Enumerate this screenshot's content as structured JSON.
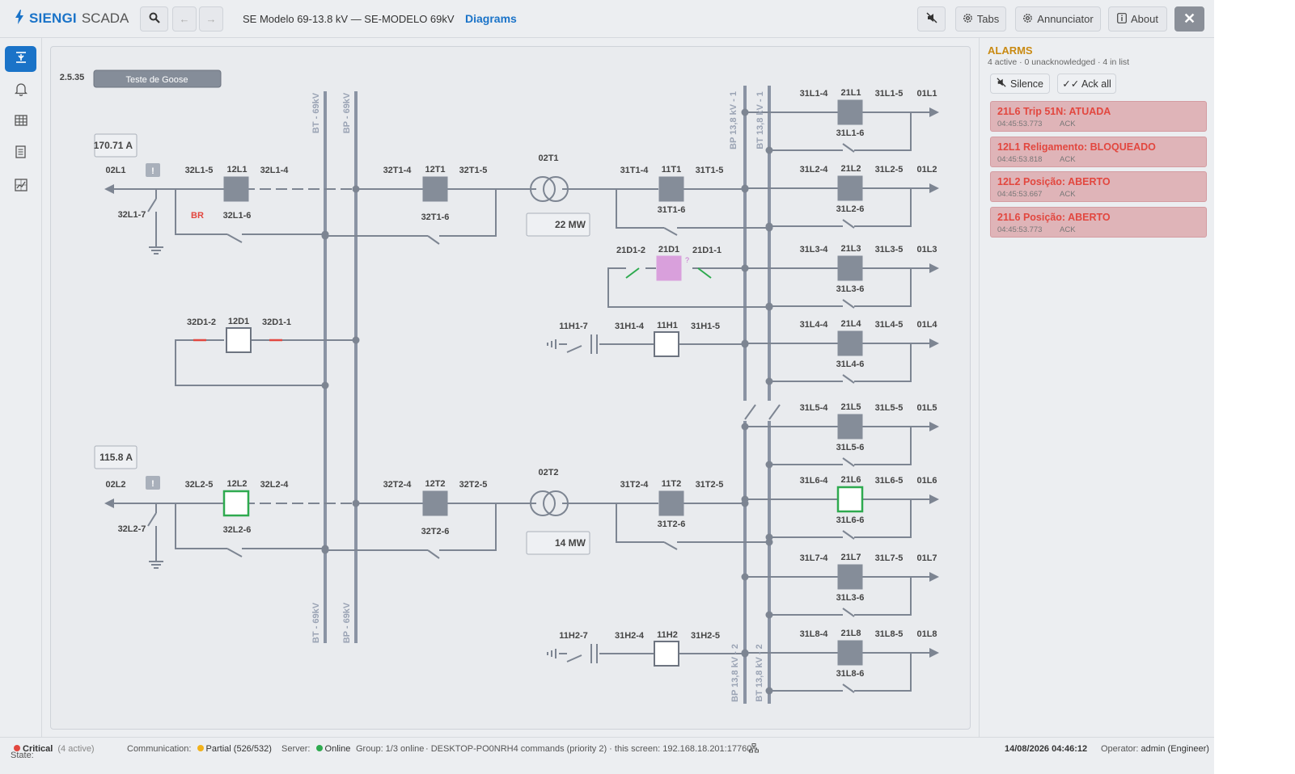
{
  "app": {
    "brand_primary": "SIENGI",
    "brand_secondary": "SCADA",
    "window_title": "SE Modelo 69-13.8 kV — SE-MODELO 69kV",
    "diagrams_link": "Diagrams",
    "back_glyph": "←",
    "forward_glyph": "→",
    "tabs_label": "Tabs",
    "annunciator_label": "Annunciator",
    "about_label": "About",
    "close_glyph": "✕"
  },
  "sidebar": {
    "items": [
      {
        "icon": "single-line-icon",
        "active": true
      },
      {
        "icon": "bell-icon",
        "active": false
      },
      {
        "icon": "table-icon",
        "active": false
      },
      {
        "icon": "document-icon",
        "active": false
      },
      {
        "icon": "chart-icon",
        "active": false
      }
    ]
  },
  "diagram": {
    "version": "2.5.35",
    "goose_button": "Teste de Goose",
    "readouts": {
      "l1": "170.71 A",
      "l2": "115.8 A",
      "t1": "22 MW",
      "t2": "14 MW"
    },
    "bus_labels": {
      "bt69_top": "BT - 69kV",
      "bp69_top": "BP - 69kV",
      "bt69_bot": "BT - 69kV",
      "bp69_bot": "BP - 69kV",
      "bp138_1": "BP 13,8 kV - 1",
      "bt138_1": "BT 13,8 kV - 1",
      "bp138_2": "BP 13,8 kV - 2",
      "bt138_2": "BT 13,8 kV - 2"
    },
    "labels": {
      "l02L1": "02L1",
      "l32L1_5": "32L1-5",
      "l12L1": "12L1",
      "l32L1_4": "32L1-4",
      "l32L1_7": "32L1-7",
      "lBR": "BR",
      "l32L1_6": "32L1-6",
      "l32T1_4": "32T1-4",
      "l12T1": "12T1",
      "l32T1_5": "32T1-5",
      "l32T1_6": "32T1-6",
      "l02T1": "02T1",
      "l31T1_4": "31T1-4",
      "l11T1": "11T1",
      "l31T1_5": "31T1-5",
      "l31T1_6": "31T1-6",
      "l32D1_2": "32D1-2",
      "l12D1": "12D1",
      "l32D1_1": "32D1-1",
      "l21D1_2": "21D1-2",
      "l21D1": "21D1",
      "l21D1_1": "21D1-1",
      "l11H1_7": "11H1-7",
      "l31H1_4": "31H1-4",
      "l11H1": "11H1",
      "l31H1_5": "31H1-5",
      "l02L2": "02L2",
      "l32L2_5": "32L2-5",
      "l12L2": "12L2",
      "l32L2_4": "32L2-4",
      "l32L2_7": "32L2-7",
      "l32L2_6": "32L2-6",
      "l32T2_4": "32T2-4",
      "l12T2": "12T2",
      "l32T2_5": "32T2-5",
      "l32T2_6": "32T2-6",
      "l02T2": "02T2",
      "l31T2_4": "31T2-4",
      "l11T2": "11T2",
      "l31T2_5": "31T2-5",
      "l31T2_6": "31T2-6",
      "l11H2_7": "11H2-7",
      "l31H2_4": "31H2-4",
      "l11H2": "11H2",
      "l31H2_5": "31H2-5",
      "l31L1_4": "31L1-4",
      "l21L1": "21L1",
      "l31L1_5": "31L1-5",
      "l01L1": "01L1",
      "l31L1_6": "31L1-6",
      "l31L2_4": "31L2-4",
      "l21L2": "21L2",
      "l31L2_5": "31L2-5",
      "l01L2": "01L2",
      "l31L2_6": "31L2-6",
      "l31L3_4": "31L3-4",
      "l21L3": "21L3",
      "l31L3_5": "31L3-5",
      "l01L3": "01L3",
      "l31L3_6": "31L3-6",
      "l31L4_4": "31L4-4",
      "l21L4": "21L4",
      "l31L4_5": "31L4-5",
      "l01L4": "01L4",
      "l31L4_6": "31L4-6",
      "l31L5_4": "31L5-4",
      "l21L5": "21L5",
      "l31L5_5": "31L5-5",
      "l01L5": "01L5",
      "l31L5_6": "31L5-6",
      "l31L6_4": "31L6-4",
      "l21L6": "21L6",
      "l31L6_5": "31L6-5",
      "l01L6": "01L6",
      "l31L6_6": "31L6-6",
      "l31L7_4": "31L7-4",
      "l21L7": "21L7",
      "l31L7_5": "31L7-5",
      "l01L7": "01L7",
      "l31L7_6": "31L3-6",
      "l31L8_4": "31L8-4",
      "l21L8": "21L8",
      "l31L8_5": "31L8-5",
      "l01L8": "01L8",
      "l31L8_6": "31L8-6"
    },
    "colors": {
      "bus": "#8a93a3",
      "line": "#7d8592",
      "breaker_closed": "#858d99",
      "breaker_open": "#ffffff",
      "breaker_green": "#2eaa4f",
      "breaker_magenta": "#d9a0dc",
      "label": "#444444",
      "bus_label": "#9aa3b4",
      "warning_red": "#e2473f"
    }
  },
  "alarms": {
    "title": "ALARMS",
    "summary": "4 active · 0 unacknowledged · 4 in list",
    "silence_label": "Silence",
    "ack_all_label": "✓✓ Ack all",
    "items": [
      {
        "text": "21L6 Trip 51N: ATUADA",
        "time": "04:45:53.773",
        "ack": "ACK"
      },
      {
        "text": "12L1 Religamento: BLOQUEADO",
        "time": "04:45:53.818",
        "ack": "ACK"
      },
      {
        "text": "12L2 Posição: ABERTO",
        "time": "04:45:53.667",
        "ack": "ACK"
      },
      {
        "text": "21L6 Posição: ABERTO",
        "time": "04:45:53.773",
        "ack": "ACK"
      }
    ]
  },
  "status": {
    "state_label": "State:",
    "state_value": "Critical",
    "state_extra": "(4 active)",
    "comm_label": "Communication:",
    "comm_value": "Partial (526/532)",
    "server_label": "Server:",
    "server_value": "Online",
    "group_text": "Group: 1/3 online",
    "commands_text": "· DESKTOP-PO0NRH4 commands (priority 2) · this screen: 192.168.18.201:17760",
    "datetime": "14/08/2026 04:46:12",
    "operator_label": "Operator:",
    "operator_value": "admin (Engineer)",
    "colors": {
      "critical": "#e2473f",
      "partial": "#f2b21b",
      "online": "#2eaa4f"
    }
  }
}
